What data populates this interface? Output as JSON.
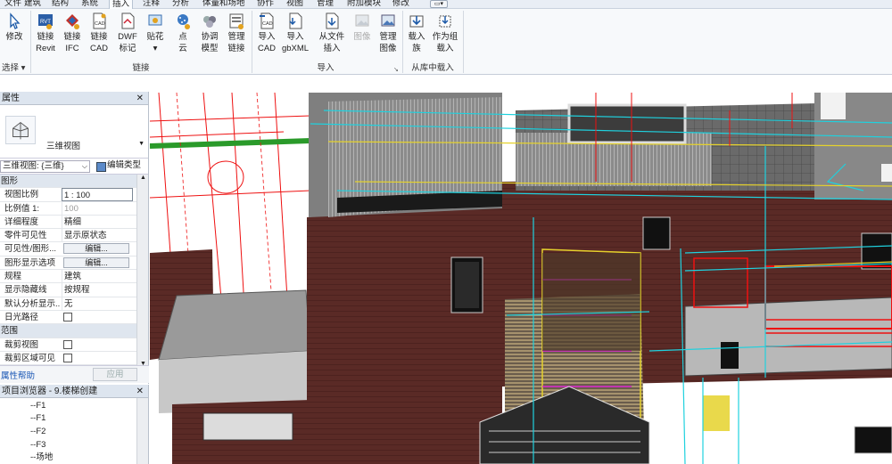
{
  "tabs": [
    "文件",
    "建筑",
    "结构",
    "系统",
    "插入",
    "注释",
    "分析",
    "体量和场地",
    "协作",
    "视图",
    "管理",
    "附加模块",
    "修改"
  ],
  "active_tab": "插入",
  "ribbon": {
    "modify": {
      "label": "修改",
      "group": "选择"
    },
    "buttons": [
      {
        "line1": "链接",
        "line2": "Revit",
        "icon": "link-revit-icon"
      },
      {
        "line1": "链接",
        "line2": "IFC",
        "icon": "link-ifc-icon"
      },
      {
        "line1": "链接",
        "line2": "CAD",
        "icon": "link-cad-icon"
      },
      {
        "line1": "DWF",
        "line2": "标记",
        "icon": "dwf-markup-icon"
      },
      {
        "line1": "贴花",
        "line2": "",
        "icon": "decal-icon"
      },
      {
        "line1": "点",
        "line2": "云",
        "icon": "point-cloud-icon"
      },
      {
        "line1": "协调",
        "line2": "模型",
        "icon": "coordination-model-icon"
      },
      {
        "line1": "管理",
        "line2": "链接",
        "icon": "manage-links-icon"
      },
      {
        "line1": "导入",
        "line2": "CAD",
        "icon": "import-cad-icon"
      },
      {
        "line1": "导入",
        "line2": "gbXML",
        "icon": "import-gbxml-icon"
      },
      {
        "line1": "从文件",
        "line2": "插入",
        "icon": "insert-from-file-icon"
      },
      {
        "line1": "图像",
        "line2": "",
        "icon": "image-icon"
      },
      {
        "line1": "管理",
        "line2": "图像",
        "icon": "manage-images-icon"
      },
      {
        "line1": "载入",
        "line2": "族",
        "icon": "load-family-icon"
      },
      {
        "line1": "作为组",
        "line2": "载入",
        "icon": "load-as-group-icon"
      }
    ],
    "groups": {
      "link": "链接",
      "import": "导入",
      "load": "从库中载入"
    }
  },
  "properties": {
    "title": "属性",
    "type_name": "三维视图",
    "view_selector": "三维视图: {三维}",
    "edit_type": "编辑类型",
    "rows": [
      {
        "kind": "section",
        "label": "图形"
      },
      {
        "kind": "value",
        "k": "视图比例",
        "v": "1 : 100",
        "style": "box"
      },
      {
        "kind": "value",
        "k": "比例值 1:",
        "v": "100",
        "style": "dim"
      },
      {
        "kind": "value",
        "k": "详细程度",
        "v": "精细"
      },
      {
        "kind": "value",
        "k": "零件可见性",
        "v": "显示原状态"
      },
      {
        "kind": "button",
        "k": "可见性/图形...",
        "v": "编辑..."
      },
      {
        "kind": "button",
        "k": "图形显示选项",
        "v": "编辑..."
      },
      {
        "kind": "value",
        "k": "规程",
        "v": "建筑"
      },
      {
        "kind": "value",
        "k": "显示隐藏线",
        "v": "按规程"
      },
      {
        "kind": "value",
        "k": "默认分析显示...",
        "v": "无"
      },
      {
        "kind": "check",
        "k": "日光路径",
        "v": ""
      },
      {
        "kind": "section",
        "label": "范围"
      },
      {
        "kind": "check",
        "k": "裁剪视图",
        "v": ""
      },
      {
        "kind": "check",
        "k": "裁剪区域可见",
        "v": ""
      }
    ],
    "help": "属性帮助",
    "apply": "应用"
  },
  "browser": {
    "title": "项目浏览器 - 9.楼梯创建",
    "items": [
      "F1",
      "F1",
      "F2",
      "F3",
      "场地"
    ]
  },
  "colors": {
    "ribbon_bg": "#f7f9fb",
    "panel_header": "#dde5ef",
    "brick": "#5a2a26",
    "roof": "#8a8a8a"
  }
}
